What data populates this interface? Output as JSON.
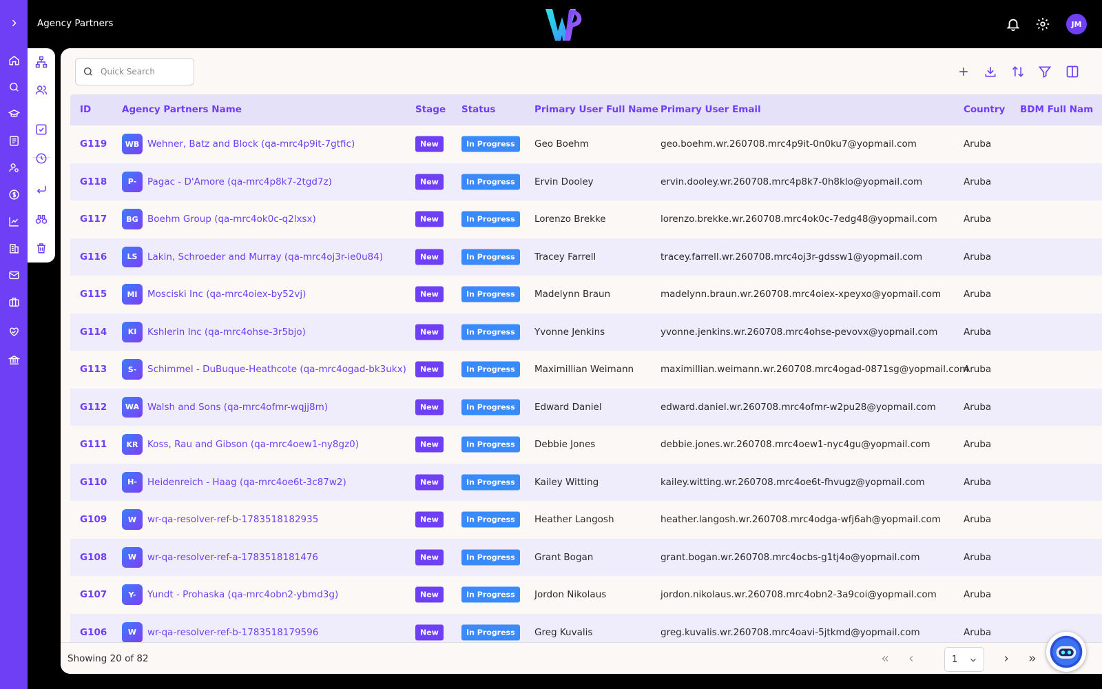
{
  "header": {
    "title": "Agency Partners",
    "logo_icon": "wr-logo",
    "avatar_initials": "JM"
  },
  "colors": {
    "accent": "#6f3ff5",
    "status": "#3b8afb",
    "row_alt": "#efedfb",
    "header_row": "#e5e1f9"
  },
  "rail": {
    "items": [
      "chevron-right-icon",
      "home-icon",
      "search-icon",
      "graduation-cap-icon",
      "document-list-icon",
      "user-settings-icon",
      "dollar-icon",
      "line-chart-icon",
      "building-icon",
      "mail-icon",
      "briefcase-icon",
      "handshake-heart-icon",
      "bank-icon"
    ]
  },
  "subbar": {
    "items": [
      "org-chart-icon",
      "users-icon",
      "checkbox-icon",
      "clock-icon",
      "return-arrow-icon",
      "binoculars-icon",
      "trash-icon"
    ]
  },
  "toolbar": {
    "search_placeholder": "Quick Search",
    "actions": [
      "plus-icon",
      "download-icon",
      "sort-icon",
      "filter-icon",
      "columns-icon"
    ]
  },
  "table": {
    "columns": [
      "ID",
      "Agency Partners Name",
      "Stage",
      "Status",
      "Primary User Full Name",
      "Primary User Email",
      "Country",
      "BDM Full Nam"
    ],
    "rows": [
      {
        "id": "G119",
        "initials": "WB",
        "name": "Wehner, Batz and Block (qa-mrc4p9it-7gtfic)",
        "stage": "New",
        "status": "In Progress",
        "user": "Geo Boehm",
        "email": "geo.boehm.wr.260708.mrc4p9it-0n0ku7@yopmail.com",
        "country": "Aruba"
      },
      {
        "id": "G118",
        "initials": "P-",
        "name": "Pagac - D'Amore (qa-mrc4p8k7-2tgd7z)",
        "stage": "New",
        "status": "In Progress",
        "user": "Ervin Dooley",
        "email": "ervin.dooley.wr.260708.mrc4p8k7-0h8klo@yopmail.com",
        "country": "Aruba"
      },
      {
        "id": "G117",
        "initials": "BG",
        "name": "Boehm Group (qa-mrc4ok0c-q2lxsx)",
        "stage": "New",
        "status": "In Progress",
        "user": "Lorenzo Brekke",
        "email": "lorenzo.brekke.wr.260708.mrc4ok0c-7edg48@yopmail.com",
        "country": "Aruba"
      },
      {
        "id": "G116",
        "initials": "LS",
        "name": "Lakin, Schroeder and Murray (qa-mrc4oj3r-ie0u84)",
        "stage": "New",
        "status": "In Progress",
        "user": "Tracey Farrell",
        "email": "tracey.farrell.wr.260708.mrc4oj3r-gdssw1@yopmail.com",
        "country": "Aruba"
      },
      {
        "id": "G115",
        "initials": "MI",
        "name": "Mosciski Inc (qa-mrc4oiex-by52vj)",
        "stage": "New",
        "status": "In Progress",
        "user": "Madelynn Braun",
        "email": "madelynn.braun.wr.260708.mrc4oiex-xpeyxo@yopmail.com",
        "country": "Aruba"
      },
      {
        "id": "G114",
        "initials": "KI",
        "name": "Kshlerin Inc (qa-mrc4ohse-3r5bjo)",
        "stage": "New",
        "status": "In Progress",
        "user": "Yvonne Jenkins",
        "email": "yvonne.jenkins.wr.260708.mrc4ohse-pevovx@yopmail.com",
        "country": "Aruba"
      },
      {
        "id": "G113",
        "initials": "S-",
        "name": "Schimmel - DuBuque-Heathcote (qa-mrc4ogad-bk3ukx)",
        "stage": "New",
        "status": "In Progress",
        "user": "Maximillian Weimann",
        "email": "maximillian.weimann.wr.260708.mrc4ogad-0871sg@yopmail.com",
        "country": "Aruba"
      },
      {
        "id": "G112",
        "initials": "WA",
        "name": "Walsh and Sons (qa-mrc4ofmr-wqjj8m)",
        "stage": "New",
        "status": "In Progress",
        "user": "Edward Daniel",
        "email": "edward.daniel.wr.260708.mrc4ofmr-w2pu28@yopmail.com",
        "country": "Aruba"
      },
      {
        "id": "G111",
        "initials": "KR",
        "name": "Koss, Rau and Gibson (qa-mrc4oew1-ny8gz0)",
        "stage": "New",
        "status": "In Progress",
        "user": "Debbie Jones",
        "email": "debbie.jones.wr.260708.mrc4oew1-nyc4gu@yopmail.com",
        "country": "Aruba"
      },
      {
        "id": "G110",
        "initials": "H-",
        "name": "Heidenreich - Haag (qa-mrc4oe6t-3c87w2)",
        "stage": "New",
        "status": "In Progress",
        "user": "Kailey Witting",
        "email": "kailey.witting.wr.260708.mrc4oe6t-fhvugz@yopmail.com",
        "country": "Aruba"
      },
      {
        "id": "G109",
        "initials": "W",
        "name": "wr-qa-resolver-ref-b-1783518182935",
        "stage": "New",
        "status": "In Progress",
        "user": "Heather Langosh",
        "email": "heather.langosh.wr.260708.mrc4odga-wfj6ah@yopmail.com",
        "country": "Aruba"
      },
      {
        "id": "G108",
        "initials": "W",
        "name": "wr-qa-resolver-ref-a-1783518181476",
        "stage": "New",
        "status": "In Progress",
        "user": "Grant Bogan",
        "email": "grant.bogan.wr.260708.mrc4ocbs-g1tj4o@yopmail.com",
        "country": "Aruba"
      },
      {
        "id": "G107",
        "initials": "Y-",
        "name": "Yundt - Prohaska (qa-mrc4obn2-ybmd3g)",
        "stage": "New",
        "status": "In Progress",
        "user": "Jordon Nikolaus",
        "email": "jordon.nikolaus.wr.260708.mrc4obn2-3a9coi@yopmail.com",
        "country": "Aruba"
      },
      {
        "id": "G106",
        "initials": "W",
        "name": "wr-qa-resolver-ref-b-1783518179596",
        "stage": "New",
        "status": "In Progress",
        "user": "Greg Kuvalis",
        "email": "greg.kuvalis.wr.260708.mrc4oavi-5jtkmd@yopmail.com",
        "country": "Aruba"
      }
    ]
  },
  "footer": {
    "showing": "Showing 20 of 82",
    "page": "1"
  }
}
